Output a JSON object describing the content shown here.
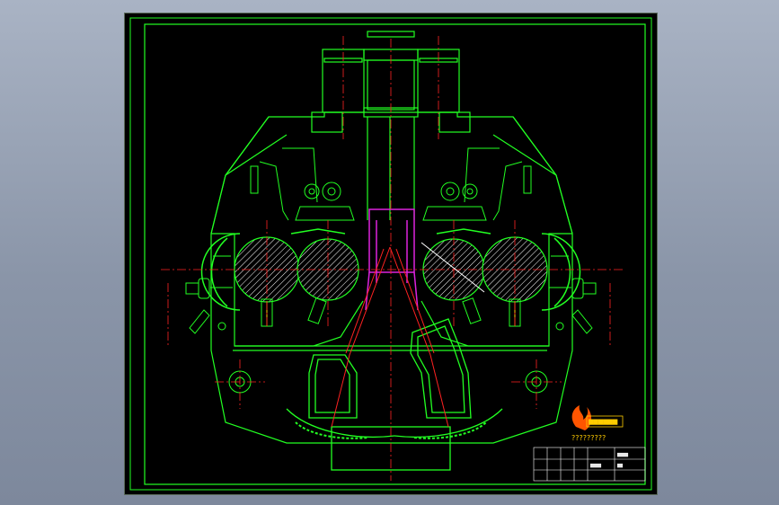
{
  "logo": {
    "icon": "flame-logo-icon",
    "caption": "?????????"
  },
  "title_block": {
    "cells": [
      "▆▆▆▆",
      "▆▆▆▆",
      "▆▆"
    ]
  },
  "colors": {
    "outline": "#22ff22",
    "centerline": "#ff2222",
    "hatch": "#ffffff",
    "pipe": "#dd22dd",
    "accent": "#ffcc00"
  }
}
